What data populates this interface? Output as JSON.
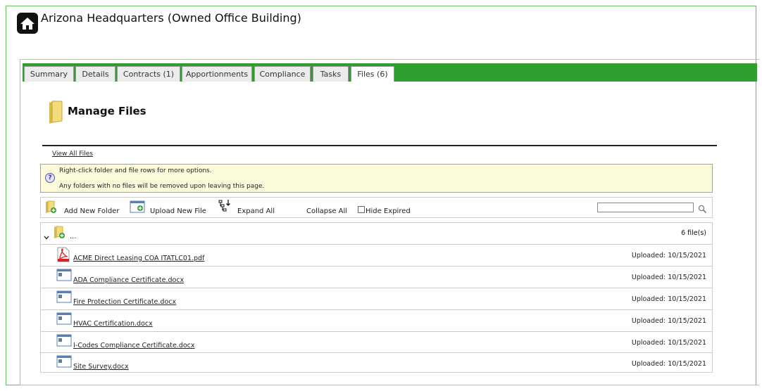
{
  "header": {
    "title": "Arizona Headquarters (Owned Office Building)"
  },
  "tabs": [
    {
      "label": "Summary"
    },
    {
      "label": "Details"
    },
    {
      "label": "Contracts  (1)"
    },
    {
      "label": "Apportionments"
    },
    {
      "label": "Compliance"
    },
    {
      "label": "Tasks"
    },
    {
      "label": "Files  (6)"
    }
  ],
  "manage": {
    "title": "Manage Files",
    "view_all": "View All Files"
  },
  "info": {
    "line1": "Right-click folder and file rows for more options.",
    "line2": "Any folders with no files will be removed upon leaving this page."
  },
  "toolbar": {
    "add_folder": "Add New Folder",
    "upload_file": "Upload New File",
    "expand_all": "Expand All",
    "collapse_all": "Collapse All",
    "hide_expired": "Hide Expired",
    "search_value": ""
  },
  "folder": {
    "label": "...",
    "count": "6 file(s)"
  },
  "files": [
    {
      "name": "ACME Direct Leasing COA ITATLC01.pdf",
      "uploaded": "Uploaded: 10/15/2021",
      "type": "pdf"
    },
    {
      "name": "ADA Compliance Certificate.docx",
      "uploaded": "Uploaded: 10/15/2021",
      "type": "docx"
    },
    {
      "name": "Fire Protection Certificate.docx",
      "uploaded": "Uploaded: 10/15/2021",
      "type": "docx"
    },
    {
      "name": "HVAC Certification.docx",
      "uploaded": "Uploaded: 10/15/2021",
      "type": "docx"
    },
    {
      "name": "I-Codes Compliance Certificate.docx",
      "uploaded": "Uploaded: 10/15/2021",
      "type": "docx"
    },
    {
      "name": "Site Survey.docx",
      "uploaded": "Uploaded: 10/15/2021",
      "type": "docx"
    }
  ],
  "colors": {
    "tabbar": "#2f9e2f",
    "info_bg": "#fbfbd9"
  }
}
